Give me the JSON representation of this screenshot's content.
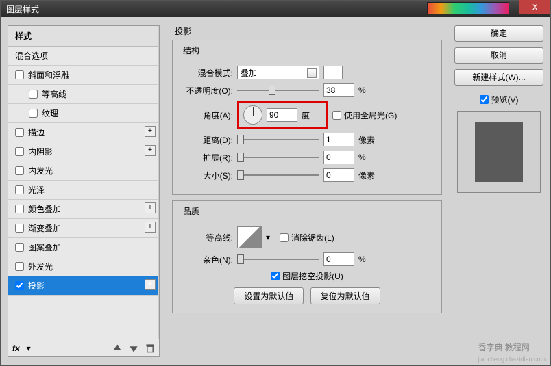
{
  "window": {
    "title": "图层样式",
    "close": "x"
  },
  "sidebar": {
    "header": "样式",
    "blending": "混合选项",
    "items": [
      {
        "label": "斜面和浮雕"
      },
      {
        "label": "等高线"
      },
      {
        "label": "纹理"
      },
      {
        "label": "描边"
      },
      {
        "label": "内阴影"
      },
      {
        "label": "内发光"
      },
      {
        "label": "光泽"
      },
      {
        "label": "颜色叠加"
      },
      {
        "label": "渐变叠加"
      },
      {
        "label": "图案叠加"
      },
      {
        "label": "外发光"
      },
      {
        "label": "投影"
      }
    ],
    "fx": "fx"
  },
  "panel": {
    "title": "投影",
    "structure": {
      "title": "结构",
      "blend_mode_label": "混合模式:",
      "blend_mode_value": "叠加",
      "opacity_label": "不透明度(O):",
      "opacity_value": "38",
      "opacity_unit": "%",
      "angle_label": "角度(A):",
      "angle_value": "90",
      "angle_unit": "度",
      "global_light": "使用全局光(G)",
      "distance_label": "距离(D):",
      "distance_value": "1",
      "distance_unit": "像素",
      "spread_label": "扩展(R):",
      "spread_value": "0",
      "spread_unit": "%",
      "size_label": "大小(S):",
      "size_value": "0",
      "size_unit": "像素"
    },
    "quality": {
      "title": "品质",
      "contour_label": "等高线:",
      "antialias": "消除锯齿(L)",
      "noise_label": "杂色(N):",
      "noise_value": "0",
      "noise_unit": "%"
    },
    "knockout": "图层挖空投影(U)",
    "make_default": "设置为默认值",
    "reset_default": "复位为默认值"
  },
  "buttons": {
    "ok": "确定",
    "cancel": "取消",
    "new_style": "新建样式(W)...",
    "preview": "预览(V)"
  },
  "watermark": {
    "main": "香字典 教程网",
    "sub": "jiaocheng.chazidian.com"
  }
}
